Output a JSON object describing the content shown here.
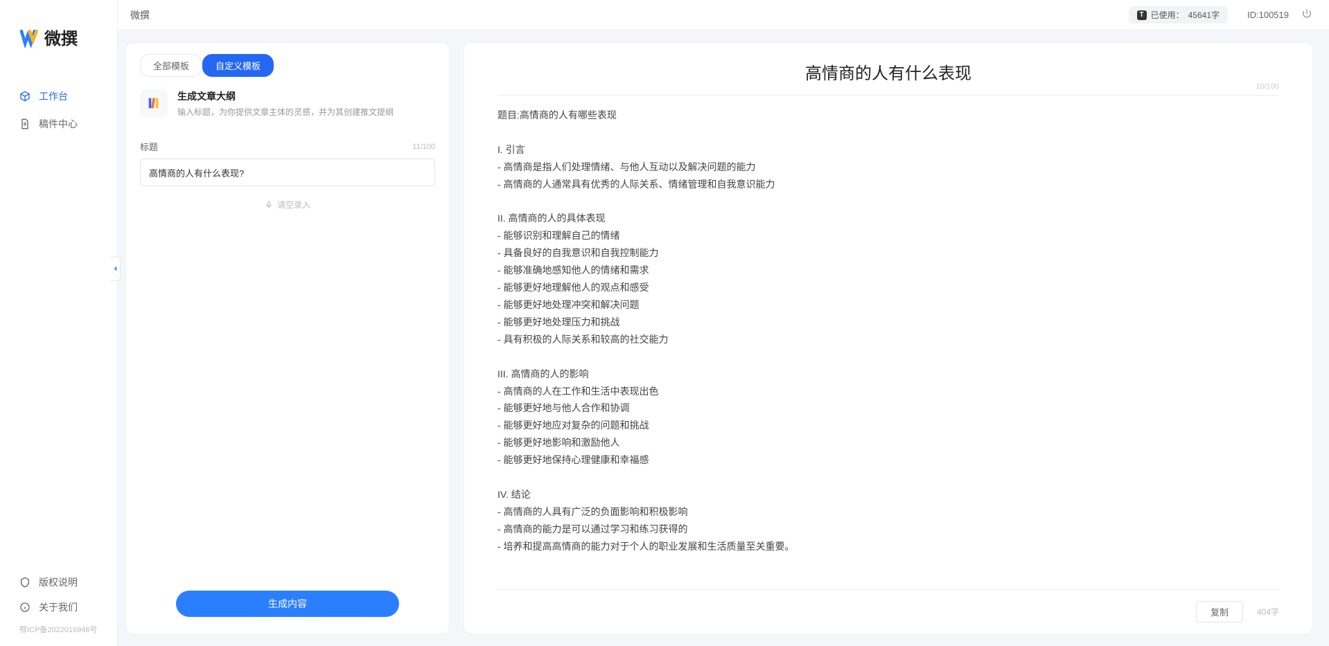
{
  "app_name_zh": "微撰",
  "topbar": {
    "title": "微撰",
    "usage_label": "已使用：",
    "usage_value": "45641字",
    "usage_badge": "T",
    "user_id_label": "ID:100519"
  },
  "sidebar": {
    "nav": [
      {
        "key": "workbench",
        "label": "工作台",
        "active": true
      },
      {
        "key": "drafts",
        "label": "稿件中心",
        "active": false
      }
    ],
    "footer": [
      {
        "key": "copyright",
        "label": "版权说明"
      },
      {
        "key": "about",
        "label": "关于我们"
      }
    ],
    "icp": "鄂ICP备2022016946号"
  },
  "left_panel": {
    "tabs": [
      {
        "key": "all",
        "label": "全部模板",
        "active": false
      },
      {
        "key": "custom",
        "label": "自定义模板",
        "active": true
      }
    ],
    "template": {
      "title": "生成文章大纲",
      "desc": "输入标题，为你提供文章主体的灵感，并为其创建推文提纲"
    },
    "field_label": "标题",
    "field_counter": "11/100",
    "field_value": "高情商的人有什么表现?",
    "voice_hint": "请空录入",
    "submit_label": "生成内容"
  },
  "right_panel": {
    "title": "高情商的人有什么表现",
    "title_counter": "10/100",
    "body": "题目:高情商的人有哪些表现\n\nI. 引言\n- 高情商是指人们处理情绪、与他人互动以及解决问题的能力\n- 高情商的人通常具有优秀的人际关系、情绪管理和自我意识能力\n\nII. 高情商的人的具体表现\n- 能够识别和理解自己的情绪\n- 具备良好的自我意识和自我控制能力\n- 能够准确地感知他人的情绪和需求\n- 能够更好地理解他人的观点和感受\n- 能够更好地处理冲突和解决问题\n- 能够更好地处理压力和挑战\n- 具有积极的人际关系和较高的社交能力\n\nIII. 高情商的人的影响\n- 高情商的人在工作和生活中表现出色\n- 能够更好地与他人合作和协调\n- 能够更好地应对复杂的问题和挑战\n- 能够更好地影响和激励他人\n- 能够更好地保持心理健康和幸福感\n\nIV. 结论\n- 高情商的人具有广泛的负面影响和积极影响\n- 高情商的能力是可以通过学习和练习获得的\n- 培养和提高高情商的能力对于个人的职业发展和生活质量至关重要。",
    "copy_label": "复制",
    "word_count": "404字"
  }
}
